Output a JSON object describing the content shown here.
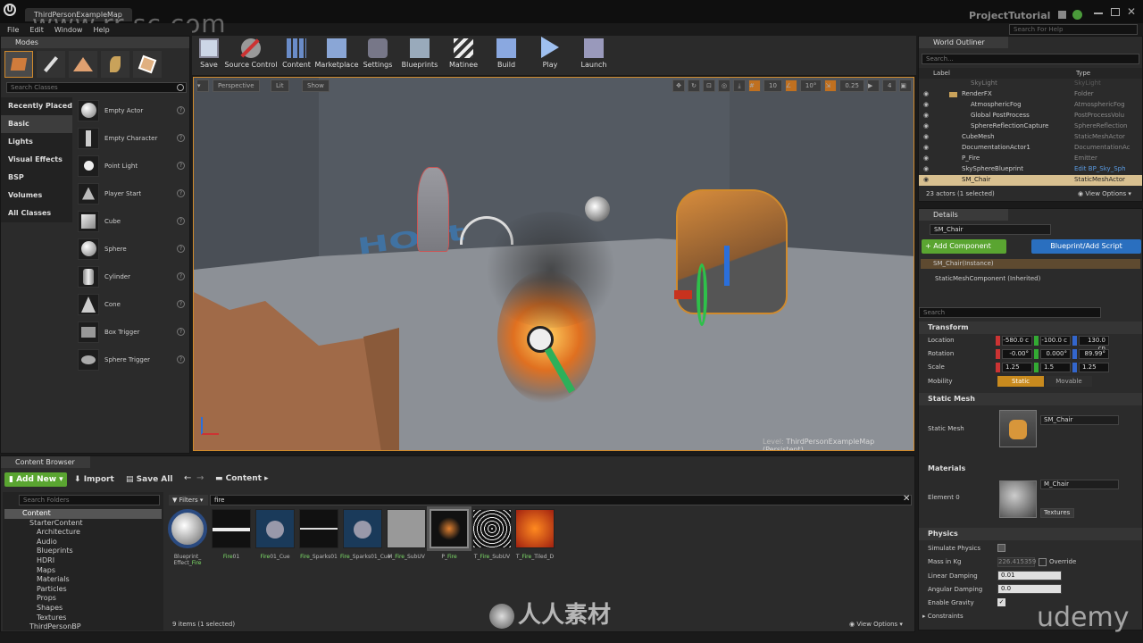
{
  "window": {
    "tab_title": "ThirdPersonExampleMap",
    "project": "ProjectTutorial",
    "help_search": "Search For Help"
  },
  "watermark": {
    "site": "www.rr-sc.com",
    "brand": "人人素材",
    "udemy": "udemy"
  },
  "menu": [
    "File",
    "Edit",
    "Window",
    "Help"
  ],
  "modes": {
    "tab": "Modes",
    "search_placeholder": "Search Classes",
    "categories": [
      "Recently Placed",
      "Basic",
      "Lights",
      "Visual Effects",
      "BSP",
      "Volumes",
      "All Classes"
    ],
    "selected_category": "Basic",
    "items": [
      "Empty Actor",
      "Empty Character",
      "Point Light",
      "Player Start",
      "Cube",
      "Sphere",
      "Cylinder",
      "Cone",
      "Box Trigger",
      "Sphere Trigger"
    ]
  },
  "toolbar": [
    "Save",
    "Source Control",
    "Content",
    "Marketplace",
    "Settings",
    "Blueprints",
    "Matinee",
    "Build",
    "Play",
    "Launch"
  ],
  "viewport": {
    "perspective": "Perspective",
    "lit": "Lit",
    "show": "Show",
    "grid_snap": "10",
    "rot_snap": "10°",
    "scale_snap": "0.25",
    "cam_speed": "4",
    "level_label": "Level:",
    "level_name": "ThirdPersonExampleMap (Persistent)"
  },
  "outliner": {
    "tab": "World Outliner",
    "search_placeholder": "Search...",
    "col_label": "Label",
    "col_type": "Type",
    "rows": [
      {
        "label": "SkyLight",
        "type": "SkyLight"
      },
      {
        "label": "RenderFX",
        "type": "Folder"
      },
      {
        "label": "AtmosphericFog",
        "type": "AtmosphericFog"
      },
      {
        "label": "Global PostProcess",
        "type": "PostProcessVolu"
      },
      {
        "label": "SphereReflectionCapture",
        "type": "SphereReflection"
      },
      {
        "label": "CubeMesh",
        "type": "StaticMeshActor"
      },
      {
        "label": "DocumentationActor1",
        "type": "DocumentationAc"
      },
      {
        "label": "P_Fire",
        "type": "Emitter"
      },
      {
        "label": "SkySphereBlueprint",
        "type": "Edit BP_Sky_Sph"
      },
      {
        "label": "SM_Chair",
        "type": "StaticMeshActor"
      }
    ],
    "status": "23 actors (1 selected)",
    "view_options": "View Options"
  },
  "details": {
    "tab": "Details",
    "name": "SM_Chair",
    "add_component": "+ Add Component",
    "blueprint_script": "Blueprint/Add Script",
    "instance": "SM_Chair(Instance)",
    "component": "StaticMeshComponent (Inherited)",
    "search_placeholder": "Search",
    "transform": {
      "header": "Transform",
      "location_label": "Location",
      "location": [
        "-580.0 c",
        "-100.0 c",
        "130.0 cn"
      ],
      "rotation_label": "Rotation",
      "rotation": [
        "-0.00°",
        "0.000°",
        "89.99°"
      ],
      "scale_label": "Scale",
      "scale": [
        "1.25",
        "1.5",
        "1.25"
      ],
      "mobility_label": "Mobility",
      "static": "Static",
      "movable": "Movable"
    },
    "static_mesh": {
      "header": "Static Mesh",
      "label": "Static Mesh",
      "value": "SM_Chair"
    },
    "materials": {
      "header": "Materials",
      "element": "Element 0",
      "value": "M_Chair",
      "textures": "Textures"
    },
    "physics": {
      "header": "Physics",
      "simulate": "Simulate Physics",
      "mass_label": "Mass in Kg",
      "mass": "226.415359",
      "override": "Override",
      "linear_label": "Linear Damping",
      "linear": "0.01",
      "angular_label": "Angular Damping",
      "angular": "0.0",
      "gravity_label": "Enable Gravity",
      "constraints": "Constraints"
    }
  },
  "content_browser": {
    "tab": "Content Browser",
    "add_new": "Add New",
    "import": "Import",
    "save_all": "Save All",
    "path": "Content",
    "folder_search": "Search Folders",
    "filters": "Filters",
    "search_value": "fire",
    "folders": [
      "Content",
      "StarterContent",
      "Architecture",
      "Audio",
      "Blueprints",
      "HDRI",
      "Maps",
      "Materials",
      "Particles",
      "Props",
      "Shapes",
      "Textures",
      "ThirdPersonBP"
    ],
    "assets": [
      {
        "pre": "Blueprint_",
        "mid": "Effect_",
        "hl": "Fire",
        "post": ""
      },
      {
        "pre": "",
        "mid": "",
        "hl": "Fire",
        "post": "01"
      },
      {
        "pre": "",
        "mid": "",
        "hl": "Fire",
        "post": "01_Cue"
      },
      {
        "pre": "",
        "mid": "",
        "hl": "Fire",
        "post": "_Sparks01"
      },
      {
        "pre": "",
        "mid": "",
        "hl": "Fire",
        "post": "_Sparks01_Cue"
      },
      {
        "pre": "M_",
        "mid": "",
        "hl": "Fire",
        "post": "_SubUV"
      },
      {
        "pre": "P_",
        "mid": "",
        "hl": "Fire",
        "post": ""
      },
      {
        "pre": "T_",
        "mid": "",
        "hl": "Fire",
        "post": "_SubUV"
      },
      {
        "pre": "T_",
        "mid": "",
        "hl": "Fire",
        "post": "_Tiled_D"
      }
    ],
    "status": "9 items (1 selected)",
    "view_options": "View Options"
  },
  "colors": {
    "accent_green": "#5aa531",
    "accent_blue": "#2a6fbf",
    "selection": "#d08a2c"
  }
}
